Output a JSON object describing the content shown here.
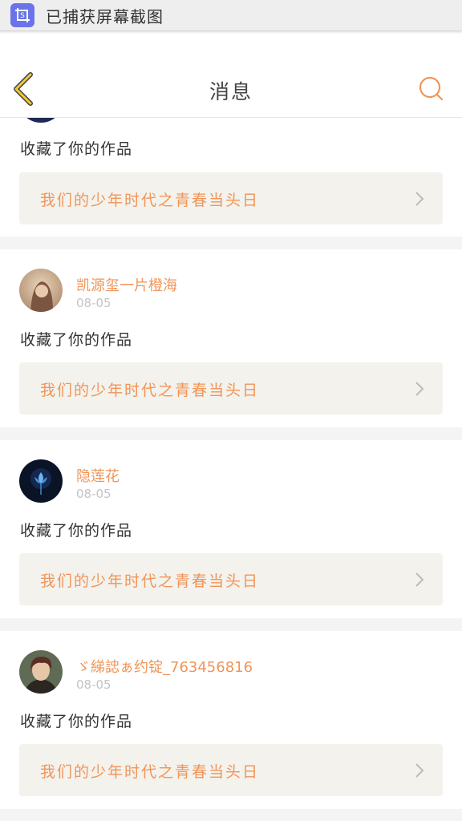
{
  "notification": {
    "text": "已捕获屏幕截图",
    "icon": "screenshot-icon",
    "icon_color": "#6a74e8"
  },
  "header": {
    "title": "消息",
    "back_icon": "chevron-left-icon",
    "search_icon": "search-icon",
    "back_color": "#f2b51f",
    "search_color": "#f0955a"
  },
  "colors": {
    "accent": "#f0955a",
    "work_box_bg": "#f3f2ec",
    "page_bg": "#f4f4f4"
  },
  "messages": [
    {
      "user": "",
      "time": "",
      "action": "收藏了你的作品",
      "work_title": "我们的少年时代之青春当头日",
      "partial": true
    },
    {
      "user": "凯源玺一片橙海",
      "time": "08-05",
      "action": "收藏了你的作品",
      "work_title": "我们的少年时代之青春当头日",
      "avatar": "avatar-girl-icon"
    },
    {
      "user": "隐莲花",
      "time": "08-05",
      "action": "收藏了你的作品",
      "work_title": "我们的少年时代之青春当头日",
      "avatar": "avatar-lotus-icon"
    },
    {
      "user": "ゞ綈䛱ぁ约锭_763456816",
      "time": "08-05",
      "action": "收藏了你的作品",
      "work_title": "我们的少年时代之青春当头日",
      "avatar": "avatar-boy-icon"
    }
  ]
}
